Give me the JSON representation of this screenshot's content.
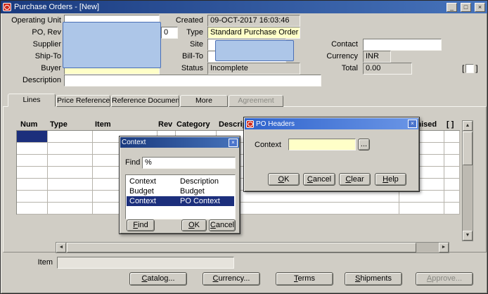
{
  "window": {
    "title": "Purchase Orders - [New]",
    "controls": {
      "minimize": "_",
      "restore": "□",
      "close": "×"
    }
  },
  "icons": {
    "close": "×",
    "up_arrow": "▲",
    "down_arrow": "▼",
    "left_arrow": "◄",
    "right_arrow": "►",
    "bracket_open": "[",
    "bracket_close": "]"
  },
  "form": {
    "operating_unit_label": "Operating Unit",
    "operating_unit_value": "",
    "po_rev_label": "PO, Rev",
    "po_value": "",
    "rev_value": "0",
    "supplier_label": "Supplier",
    "supplier_value": "",
    "ship_to_label": "Ship-To",
    "ship_to_value": "",
    "buyer_label": "Buyer",
    "buyer_value": "",
    "description_label": "Description",
    "description_value": "",
    "created_label": "Created",
    "created_value": "09-OCT-2017 16:03:46",
    "type_label": "Type",
    "type_value": "Standard Purchase Order",
    "site_label": "Site",
    "site_value": "",
    "bill_to_label": "Bill-To",
    "bill_to_value": "",
    "status_label": "Status",
    "status_value": "Incomplete",
    "contact_label": "Contact",
    "contact_value": "",
    "currency_label": "Currency",
    "currency_value": "INR",
    "total_label": "Total",
    "total_value": "0.00"
  },
  "tabs": [
    {
      "label": "Lines",
      "active": true
    },
    {
      "label": "Price Reference",
      "active": false
    },
    {
      "label": "Reference Documents",
      "active": false
    },
    {
      "label": "More",
      "active": false
    },
    {
      "label": "Agreement",
      "active": false,
      "disabled": true
    }
  ],
  "lines_table": {
    "headers": [
      "Num",
      "Type",
      "Item",
      "Rev",
      "Category",
      "Description",
      "Promised",
      "[ ]"
    ],
    "row_count": 7,
    "rows": []
  },
  "context_dialog": {
    "title": "Context",
    "find_label": "Find",
    "find_value": "%",
    "list_headers": [
      "Context",
      "Description"
    ],
    "rows": [
      {
        "context": "Budget",
        "description": "Budget"
      },
      {
        "context": "Context",
        "description": "PO Context"
      }
    ],
    "selected_row_index": 1,
    "find_button": "Find",
    "ok_button": "OK",
    "cancel_button": "Cancel"
  },
  "po_headers_dialog": {
    "title": "PO Headers",
    "context_label": "Context",
    "context_value": "",
    "lov_button": "...",
    "ok_button": "OK",
    "cancel_button": "Cancel",
    "clear_button": "Clear",
    "help_button": "Help"
  },
  "footer": {
    "item_label": "Item",
    "item_value": "",
    "buttons": [
      "Catalog...",
      "Currency...",
      "Terms",
      "Shipments",
      "Approve..."
    ]
  },
  "colors": {
    "canvas_gray": "#d0cdc5",
    "titlebar_blue_dark": "#1a3a7e",
    "titlebar_blue_light": "#4673bb",
    "dialog_blue_dark": "#2f63cc",
    "dialog_blue_light": "#6b96e6",
    "required_yellow": "#ffffc8",
    "selection_navy": "#1c2f7c",
    "redaction_fill": "#adc6e8",
    "redaction_border": "#4a6fb5"
  }
}
